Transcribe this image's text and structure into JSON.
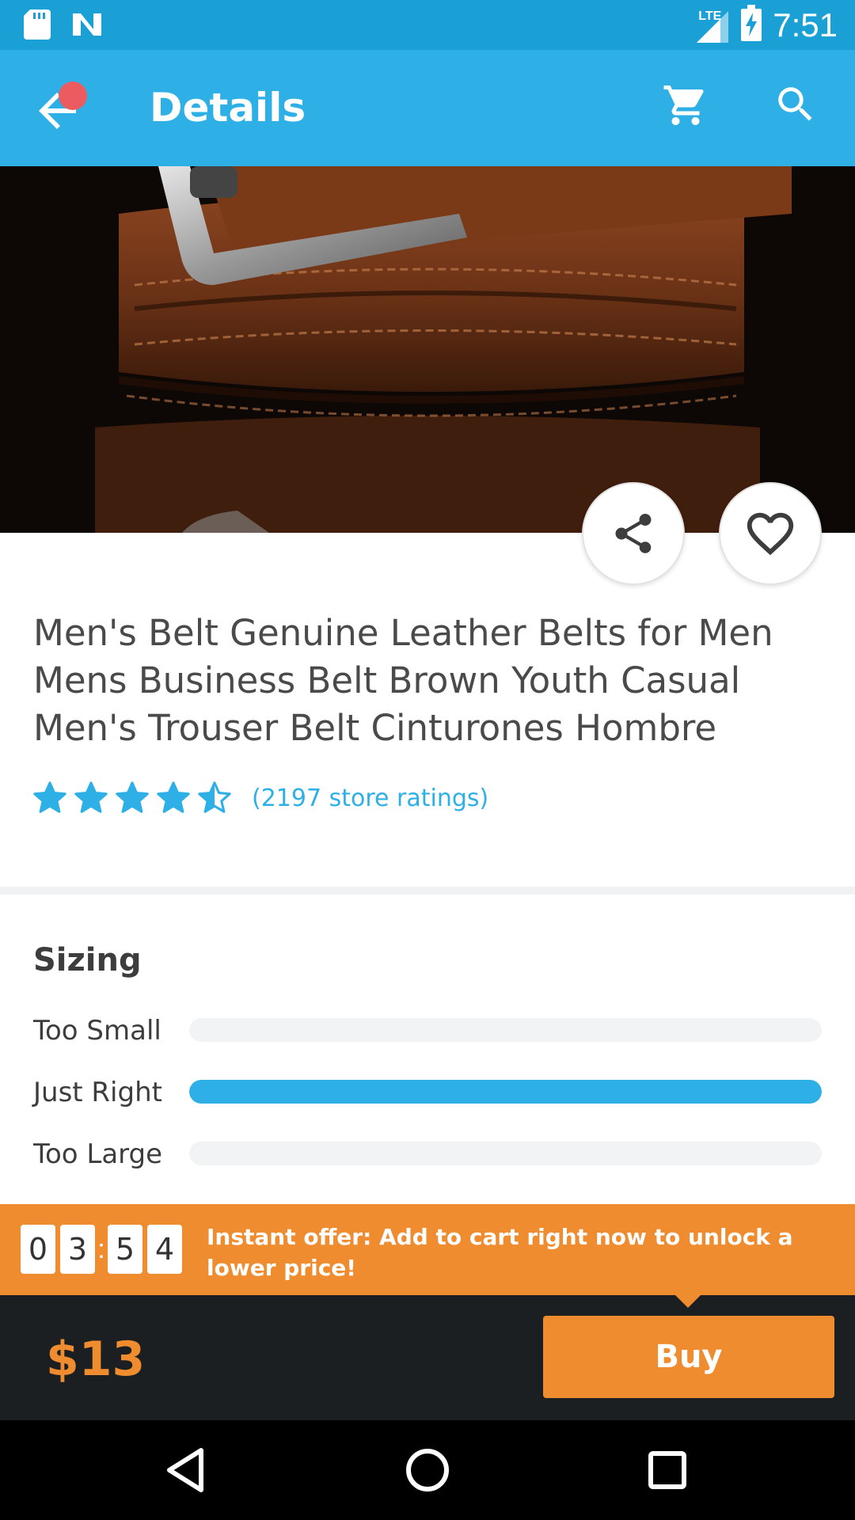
{
  "status_bar": {
    "time": "7:51",
    "network": "LTE",
    "icons": [
      "sd-card-icon",
      "n-notification-icon",
      "signal-icon",
      "battery-charging-icon"
    ]
  },
  "app_bar": {
    "title": "Details",
    "icons": [
      "back-arrow-icon",
      "cart-icon",
      "search-icon"
    ],
    "notification_dot_color": "#ec5b60"
  },
  "product": {
    "title": "Men's Belt Genuine Leather Belts for Men Mens Business Belt Brown Youth Casual Men's Trouser Belt Cinturones Hombre",
    "rating": 4.5,
    "rating_max": 5,
    "ratings_text": "(2197 store ratings)"
  },
  "sizing": {
    "title": "Sizing",
    "rows": [
      {
        "label": "Too Small",
        "fraction": 0.0
      },
      {
        "label": "Just Right",
        "fraction": 1.0
      },
      {
        "label": "Too Large",
        "fraction": 0.0
      }
    ]
  },
  "offer": {
    "timer_digits": [
      "0",
      "3",
      "5",
      "4"
    ],
    "text": "Instant offer: Add to cart right now to unlock a lower price!"
  },
  "buy_bar": {
    "price": "$13",
    "buy_label": "Buy"
  },
  "colors": {
    "accent": "#2eb0e6",
    "status_bar": "#1ba0d6",
    "offer": "#ee8c2f",
    "buy_bar_bg": "#1c1f22"
  },
  "nav_bar": {
    "icons": [
      "back-triangle-icon",
      "home-circle-icon",
      "recents-square-icon"
    ]
  }
}
